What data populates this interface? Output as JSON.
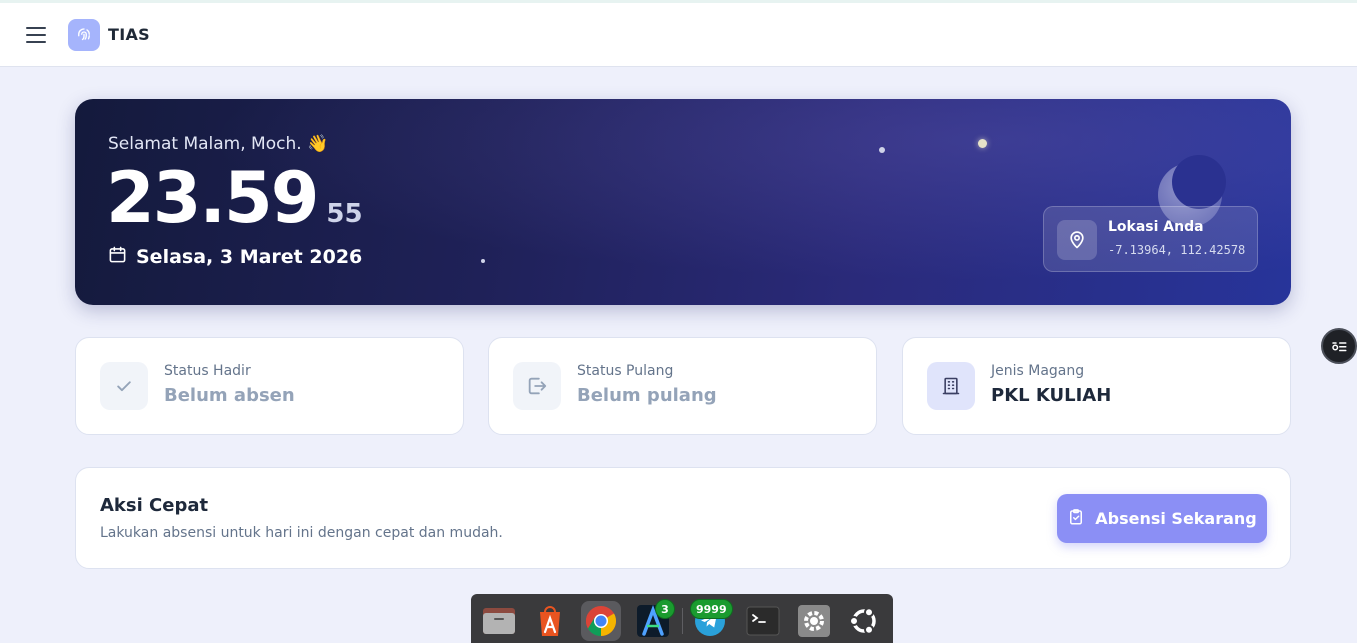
{
  "header": {
    "app_name": "TIAS"
  },
  "hero": {
    "greeting": "Selamat Malam, Moch. 👋",
    "time_main": "23.59",
    "time_seconds": "55",
    "date": "Selasa, 3 Maret 2026",
    "location": {
      "title": "Lokasi Anda",
      "coordinates": "-7.13964, 112.42578"
    }
  },
  "stats": [
    {
      "label": "Status Hadir",
      "value": "Belum absen",
      "icon": "check-icon"
    },
    {
      "label": "Status Pulang",
      "value": "Belum pulang",
      "icon": "logout-icon"
    },
    {
      "label": "Jenis Magang",
      "value": "PKL KULIAH",
      "icon": "building-icon"
    }
  ],
  "quick_action": {
    "title": "Aksi Cepat",
    "subtitle": "Lakukan absensi untuk hari ini dengan cepat dan mudah.",
    "button_label": "Absensi Sekarang"
  },
  "dock": {
    "apps": [
      {
        "name": "files",
        "icon": "folder-icon"
      },
      {
        "name": "app-center",
        "icon": "app-store-icon"
      },
      {
        "name": "chrome",
        "icon": "chrome-icon",
        "active": true
      },
      {
        "name": "android-studio",
        "icon": "android-studio-icon",
        "badge": "3"
      },
      {
        "name": "telegram",
        "icon": "telegram-icon",
        "badge": "9999"
      },
      {
        "name": "terminal",
        "icon": "terminal-icon"
      },
      {
        "name": "settings",
        "icon": "settings-icon"
      },
      {
        "name": "ubuntu",
        "icon": "ubuntu-icon"
      }
    ]
  },
  "colors": {
    "accent": "#8b8ff5",
    "hero_start": "#141a3c",
    "hero_end": "#27349a",
    "logo_badge": "#a5b4fc",
    "page_bg": "#eef0fb"
  }
}
